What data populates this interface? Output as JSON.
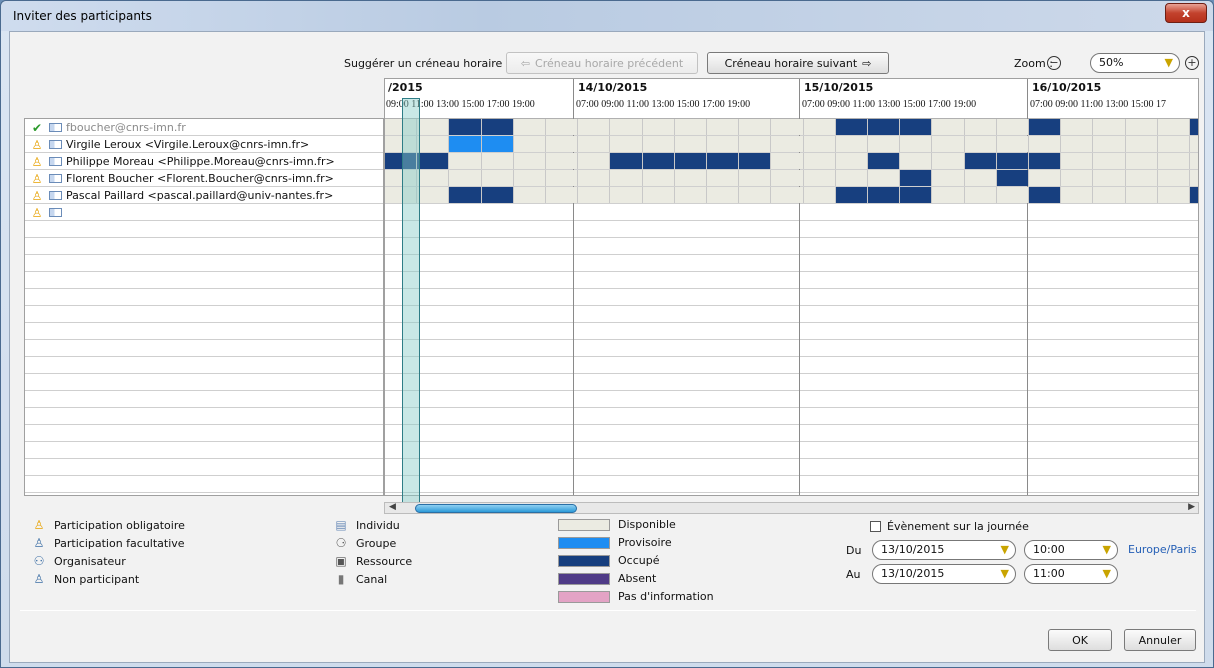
{
  "window": {
    "title": "Inviter des participants",
    "close_label": "x"
  },
  "toolbar": {
    "suggest_label": "Suggérer un créneau horaire :",
    "prev_label": "Créneau horaire précédent",
    "next_label": "Créneau horaire suivant",
    "zoom_label": "Zoom :",
    "zoom_value": "50%"
  },
  "grid": {
    "dates": [
      "/2015",
      "14/10/2015",
      "15/10/2015",
      "16/10/2015"
    ],
    "hours_first": "09:00 11:00 13:00 15:00 17:00 19:00",
    "hours_day": "07:00 09:00 11:00 13:00 15:00 17:00 19:00",
    "hours_last": "07:00 09:00 11:00 13:00 15:00 17"
  },
  "participants": [
    {
      "name": "fboucher@cnrs-imn.fr",
      "role": "organizer",
      "role_icon": "check-icon"
    },
    {
      "name": "Virgile Leroux <Virgile.Leroux@cnrs-imn.fr>",
      "role": "required",
      "role_icon": "person-icon"
    },
    {
      "name": "Philippe Moreau <Philippe.Moreau@cnrs-imn.fr>",
      "role": "required",
      "role_icon": "person-icon"
    },
    {
      "name": "Florent Boucher <Florent.Boucher@cnrs-imn.fr>",
      "role": "required",
      "role_icon": "person-icon"
    },
    {
      "name": "Pascal Paillard <pascal.paillard@univ-nantes.fr>",
      "role": "required",
      "role_icon": "person-icon"
    },
    {
      "name": "",
      "role": "required",
      "role_icon": "person-icon"
    }
  ],
  "freebusy": [
    [
      0,
      0,
      1,
      1,
      0,
      0,
      0,
      0,
      0,
      0,
      0,
      0,
      0,
      0,
      1,
      1,
      1,
      0,
      0,
      0,
      1,
      0,
      0,
      0,
      0,
      1,
      1
    ],
    [
      0,
      0,
      2,
      2,
      0,
      0,
      0,
      0,
      0,
      0,
      0,
      0,
      0,
      0,
      0,
      0,
      0,
      0,
      0,
      0,
      0,
      0,
      0,
      0,
      0,
      0,
      0
    ],
    [
      1,
      1,
      0,
      0,
      0,
      0,
      0,
      1,
      1,
      1,
      1,
      1,
      0,
      0,
      0,
      1,
      0,
      0,
      1,
      1,
      1,
      0,
      0,
      0,
      0,
      0,
      1
    ],
    [
      0,
      0,
      0,
      0,
      0,
      0,
      0,
      0,
      0,
      0,
      0,
      0,
      0,
      0,
      0,
      0,
      1,
      0,
      0,
      1,
      0,
      0,
      0,
      0,
      0,
      0,
      0
    ],
    [
      0,
      0,
      1,
      1,
      0,
      0,
      0,
      0,
      0,
      0,
      0,
      0,
      0,
      0,
      1,
      1,
      1,
      0,
      0,
      0,
      1,
      0,
      0,
      0,
      0,
      1,
      1
    ]
  ],
  "legend": {
    "attendance": [
      {
        "label": "Participation obligatoire",
        "icon": "person-icon"
      },
      {
        "label": "Participation facultative",
        "icon": "person-outline-icon"
      },
      {
        "label": "Organisateur",
        "icon": "organizer-icon"
      },
      {
        "label": "Non participant",
        "icon": "non-participant-icon"
      }
    ],
    "types": [
      {
        "label": "Individu",
        "icon": "card-icon"
      },
      {
        "label": "Groupe",
        "icon": "group-icon"
      },
      {
        "label": "Ressource",
        "icon": "resource-icon"
      },
      {
        "label": "Canal",
        "icon": "room-icon"
      }
    ],
    "status": [
      {
        "label": "Disponible",
        "color": "#ebebe2"
      },
      {
        "label": "Provisoire",
        "color": "#1e8df2"
      },
      {
        "label": "Occupé",
        "color": "#173f7f"
      },
      {
        "label": "Absent",
        "color": "#4f3b87"
      },
      {
        "label": "Pas d'information",
        "color": "#e3a3c5"
      }
    ]
  },
  "event": {
    "allday_label": "Évènement sur la journée",
    "from_label": "Du",
    "to_label": "Au",
    "start_date": "13/10/2015",
    "start_time": "10:00",
    "end_date": "13/10/2015",
    "end_time": "11:00",
    "timezone": "Europe/Paris"
  },
  "buttons": {
    "ok": "OK",
    "cancel": "Annuler"
  }
}
